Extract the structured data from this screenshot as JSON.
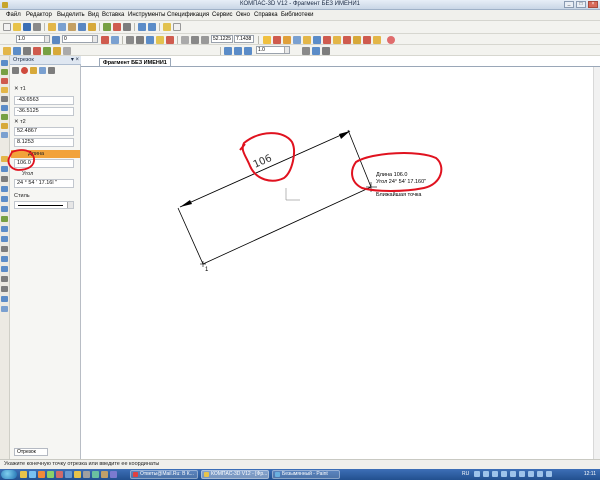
{
  "window": {
    "title": "КОМПАС-3D V12 - Фрагмент БЕЗ ИМЕНИ1"
  },
  "menu": {
    "items": [
      "Файл",
      "Редактор",
      "Выделить",
      "Вид",
      "Вставка",
      "Инструменты",
      "Спецификация",
      "Сервис",
      "Окно",
      "Справка",
      "Библиотеки"
    ]
  },
  "toolbar": {
    "scale_value": "1.0",
    "layer_value": "0",
    "zoom_value": "1.0",
    "coord_x": "52.1225",
    "coord_y": "7.1438"
  },
  "panel": {
    "title": "Отрезок",
    "p1_label": "т1",
    "p1_x": "-43.6563",
    "p1_y": "-36.5125",
    "p2_label": "т2",
    "p2_x": "52.4867",
    "p2_y": "8.1253",
    "length_label": "Длина",
    "length_value": "106.0",
    "angle_label": "Угол",
    "angle_value": "24 ° 54 ' 17.16l \"",
    "style_label": "Стиль",
    "tab_label": "Отрезок"
  },
  "document": {
    "tab": "Фрагмент БЕЗ ИМЕНИ1",
    "dimension_text": "106",
    "tooltip_length": "Длина 106.0",
    "tooltip_angle": "Угол  24° 54' 17.160\"",
    "snap_hint": "Ближайшая точка",
    "point_label": "1"
  },
  "statusbar": {
    "text": "Укажите конечную точку отрезка или введите ее координаты"
  },
  "taskbar": {
    "buttons": [
      "Ответы@Mail.Ru: В К...",
      "КОМПАС-3D V12 - [Фр...",
      "Безымянный - Paint"
    ],
    "lang": "RU",
    "clock": "12:11"
  },
  "colors": {
    "annotation": "#e0121f",
    "highlight": "#f2a23a",
    "accent": "#2c5ea8"
  }
}
